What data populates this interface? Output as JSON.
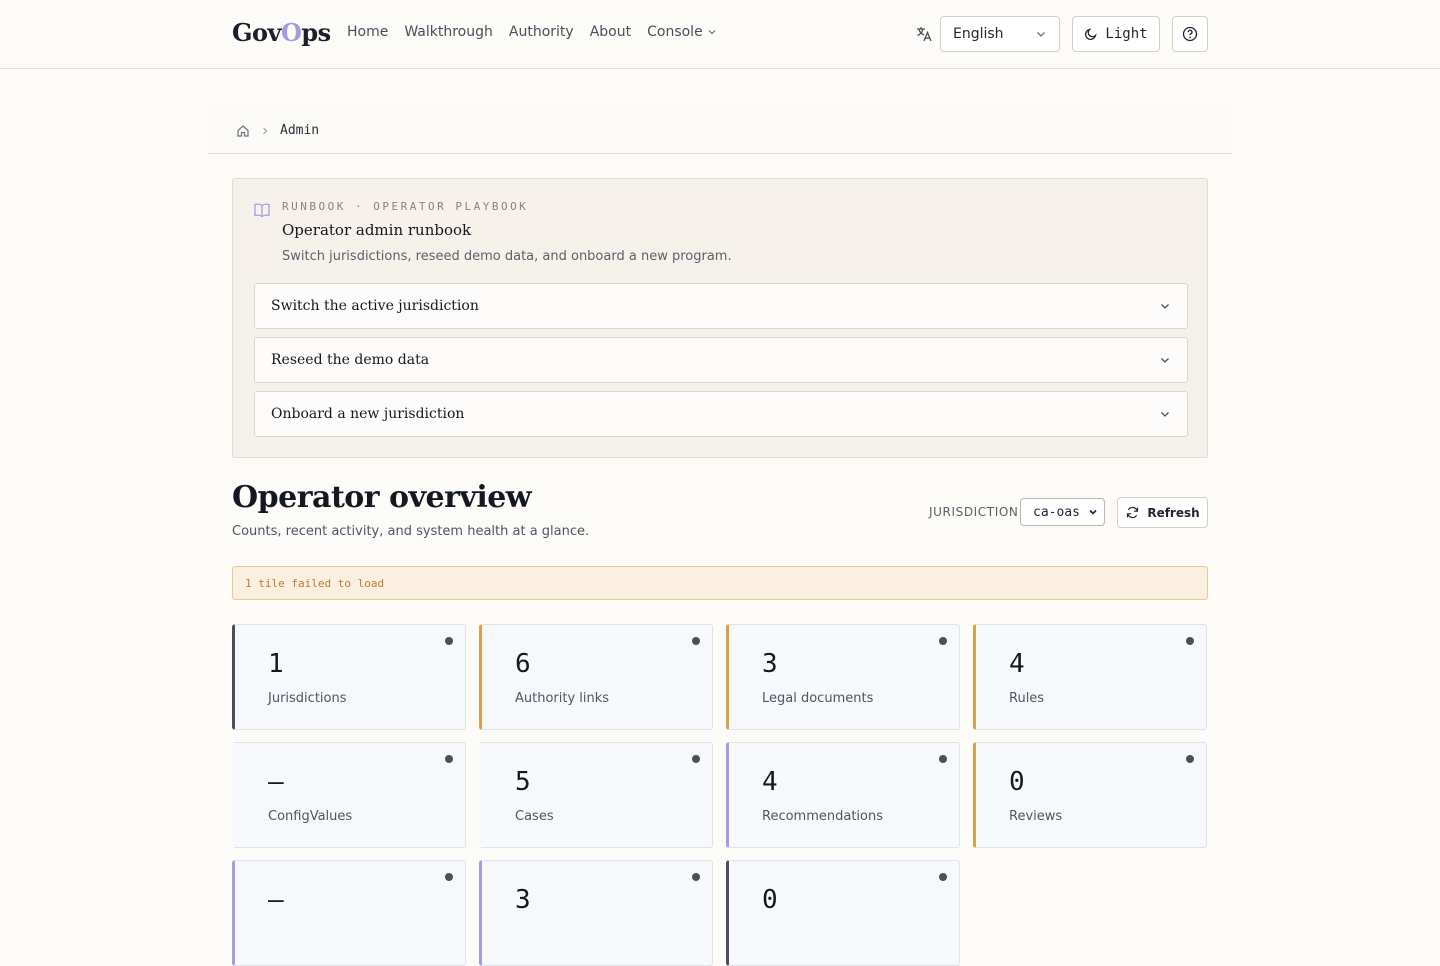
{
  "header": {
    "logo_prefix": "Gov",
    "logo_o": "O",
    "logo_suffix": "ps",
    "nav": [
      "Home",
      "Walkthrough",
      "Authority",
      "About"
    ],
    "console_label": "Console",
    "language": "English",
    "theme_label": "Light"
  },
  "breadcrumb": {
    "current": "Admin"
  },
  "runbook": {
    "eyebrow": "RUNBOOK · OPERATOR PLAYBOOK",
    "title": "Operator admin runbook",
    "subtitle": "Switch jurisdictions, reseed demo data, and onboard a new program.",
    "items": [
      "Switch the active jurisdiction",
      "Reseed the demo data",
      "Onboard a new jurisdiction"
    ]
  },
  "overview": {
    "title": "Operator overview",
    "subtitle": "Counts, recent activity, and system health at a glance.",
    "jurisdiction_label": "JURISDICTION",
    "jurisdiction_value": "ca-oas",
    "refresh_label": "Refresh",
    "alert": "1 tile failed to load"
  },
  "tiles": [
    {
      "value": "1",
      "label": "Jurisdictions",
      "accent": "#4a4f5c"
    },
    {
      "value": "6",
      "label": "Authority links",
      "accent": "#d9a24a"
    },
    {
      "value": "3",
      "label": "Legal documents",
      "accent": "#d9a24a"
    },
    {
      "value": "4",
      "label": "Rules",
      "accent": "#d9a24a"
    },
    {
      "value": "—",
      "label": "ConfigValues",
      "accent": "#a79ae0",
      "accent2": "#d9a24a"
    },
    {
      "value": "5",
      "label": "Cases",
      "accent": "#a79ae0",
      "accent2": "#d9a24a"
    },
    {
      "value": "4",
      "label": "Recommendations",
      "accent": "#a79ae0"
    },
    {
      "value": "0",
      "label": "Reviews",
      "accent": "#d9a24a"
    },
    {
      "value": "—",
      "label": "",
      "accent": "#a79ae0"
    },
    {
      "value": "3",
      "label": "",
      "accent": "#a79ae0"
    },
    {
      "value": "0",
      "label": "",
      "accent": "#4a4f5c"
    }
  ]
}
